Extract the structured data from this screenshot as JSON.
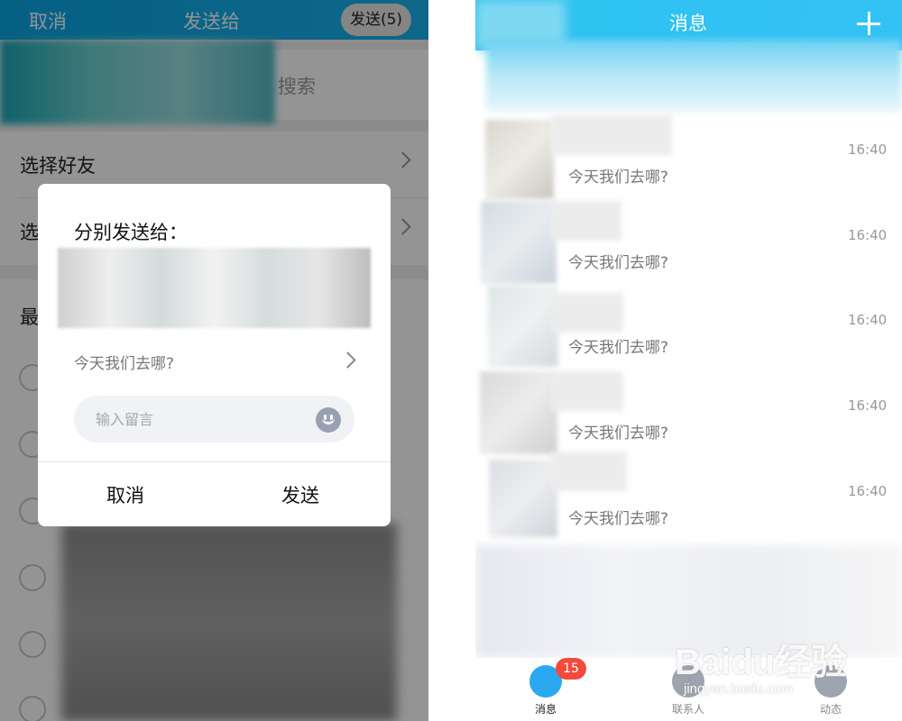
{
  "left": {
    "topbar": {
      "cancel": "取消",
      "title": "发送给",
      "send": "发送(5)"
    },
    "search": {
      "label": "搜索"
    },
    "rows": [
      {
        "label": "选择好友"
      },
      {
        "label": "选"
      }
    ],
    "recent_label": "最",
    "dialog": {
      "title": "分别发送给：",
      "message": "今天我们去哪?",
      "input_placeholder": "输入留言",
      "cancel": "取消",
      "send": "发送"
    }
  },
  "right": {
    "header": {
      "title": "消息"
    },
    "chats": [
      {
        "time": "16:40",
        "message": "今天我们去哪?"
      },
      {
        "time": "16:40",
        "message": "今天我们去哪?"
      },
      {
        "time": "16:40",
        "message": "今天我们去哪?"
      },
      {
        "time": "16:40",
        "message": "今天我们去哪?"
      },
      {
        "time": "16:40",
        "message": "今天我们去哪?"
      }
    ],
    "tabbar": {
      "messages": {
        "label": "消息",
        "badge": "15",
        "color": "#2aa9f0"
      },
      "contacts": {
        "label": "联系人"
      },
      "moments": {
        "label": "动态"
      }
    }
  },
  "watermark": {
    "brand": "Baidu经验",
    "url": "jingyan.baidu.com"
  },
  "colors": {
    "header_blue": "#19b3ee",
    "badge_red": "#f24a3c",
    "gray_text": "#777777"
  }
}
